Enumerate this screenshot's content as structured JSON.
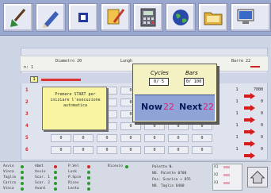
{
  "toolbar": {
    "buttons": [
      {
        "icon": "broom-icon"
      },
      {
        "icon": "pencil-icon"
      },
      {
        "icon": "square-icon"
      },
      {
        "icon": "note-edit-icon"
      },
      {
        "icon": "calculator-icon"
      },
      {
        "icon": "globe-icon"
      },
      {
        "icon": "folder-icon"
      },
      {
        "icon": "computer-icon"
      }
    ]
  },
  "info_bar": {
    "diameter_text": "Diametro 20",
    "lungh_text": "Lungh",
    "right_text": "Barre 22",
    "corner_text": "n: 1"
  },
  "grid": {
    "slot_value": "1",
    "rows": [
      {
        "index": "1",
        "cells": [
          "0",
          "0",
          "0",
          "0",
          "0",
          "0",
          "0",
          "1"
        ],
        "end": "7000"
      },
      {
        "index": "2",
        "cells": [
          "0",
          "0",
          "0",
          "0",
          "0",
          "0",
          "0",
          "1"
        ],
        "end": "0"
      },
      {
        "index": "3",
        "cells": [
          "0",
          "0",
          "0",
          "0",
          "0",
          "0",
          "0",
          "1"
        ],
        "end": "0"
      },
      {
        "index": "4",
        "cells": [
          "0",
          "0",
          "0",
          "0",
          "0",
          "0",
          "0",
          "1"
        ],
        "end": "0"
      },
      {
        "index": "5",
        "cells": [
          "0",
          "0",
          "0",
          "0",
          "0",
          "0",
          "0",
          "1"
        ],
        "end": "0"
      },
      {
        "index": "6",
        "cells": [
          "0",
          "0",
          "0",
          "0",
          "0",
          "0",
          "0",
          "1"
        ],
        "end": "0"
      }
    ]
  },
  "message_box": {
    "text": "Premere START per iniziare l'esecuzione automatica"
  },
  "counter_popup": {
    "cycles_label": "Cycles",
    "cycles_value": "0/ 5",
    "bars_label": "Bars",
    "bars_value": "0/ 100",
    "now_label": "Now",
    "now_value": "22",
    "next_label": "Next",
    "next_value": "22"
  },
  "status": {
    "col1": [
      "Avvio",
      "Vinca",
      "Taglio",
      "Carico",
      "Vinca"
    ],
    "col2": [
      "Abmt",
      "Avvio",
      "Scar. 1",
      "Scar. 2",
      "Avant"
    ],
    "col3": [
      "P.Vel",
      "Lock",
      "P.Spin",
      "Ricev",
      "Lenta"
    ],
    "col4": [
      "Ricevio"
    ],
    "info": [
      "Palette N.",
      "NO. Palette   0700",
      "Pos. Scarico  + 855",
      "NO. Taglio    0400"
    ],
    "box_lines": [
      "X1",
      "X2",
      "X3"
    ]
  },
  "colors": {
    "toolbar": "#9aa7cf",
    "popup_bottom": "#8fa3d6",
    "message_bg": "#f8f4a0",
    "accent_red": "#cc2222",
    "accent_pink": "#e0207a"
  }
}
